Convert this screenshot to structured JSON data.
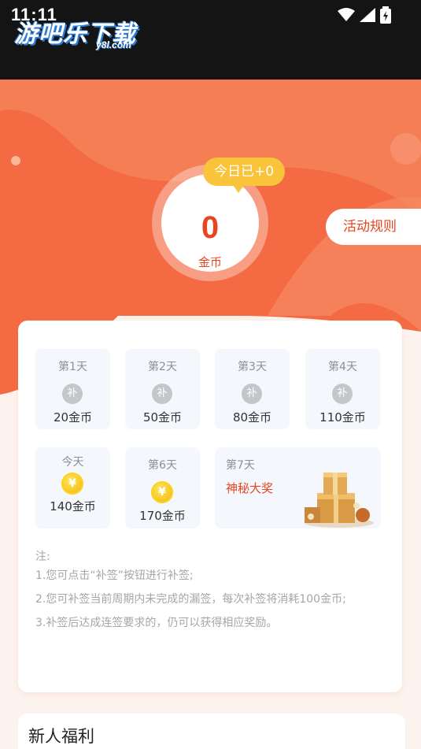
{
  "status_bar": {
    "time": "11:11"
  },
  "watermark": {
    "brand": "游吧乐下载",
    "site": "y8l.com"
  },
  "header": {
    "coins_value": "0",
    "coins_unit": "金币",
    "today_badge": "今日已+0",
    "rules_button": "活动规则"
  },
  "checkin": {
    "days": [
      {
        "title": "第1天",
        "icon": "bu-icon",
        "icon_char": "补",
        "coins": "20金币"
      },
      {
        "title": "第2天",
        "icon": "bu-icon",
        "icon_char": "补",
        "coins": "50金币"
      },
      {
        "title": "第3天",
        "icon": "bu-icon",
        "icon_char": "补",
        "coins": "80金币"
      },
      {
        "title": "第4天",
        "icon": "bu-icon",
        "icon_char": "补",
        "coins": "110金币"
      },
      {
        "title": "今天",
        "icon": "gold-coin-icon",
        "icon_char": "¥",
        "coins": "140金币"
      },
      {
        "title": "第6天",
        "icon": "gold-coin-icon",
        "icon_char": "¥",
        "coins": "170金币"
      }
    ],
    "day7": {
      "title": "第7天",
      "prize": "神秘大奖",
      "icon": "gift-boxes-icon"
    }
  },
  "notes": {
    "heading": "注:",
    "items": [
      "1.您可点击“补签”按钮进行补签;",
      "2.您可补签当前周期内未完成的漏签，每次补签将消耗100金币;",
      "3.补签后达成连签要求的，仍可以获得相应奖励。"
    ]
  },
  "newbie": {
    "title": "新人福利"
  },
  "colors": {
    "accent": "#e8451f",
    "hero_orange": "#f46a43",
    "badge_yellow": "#f9c33a"
  }
}
